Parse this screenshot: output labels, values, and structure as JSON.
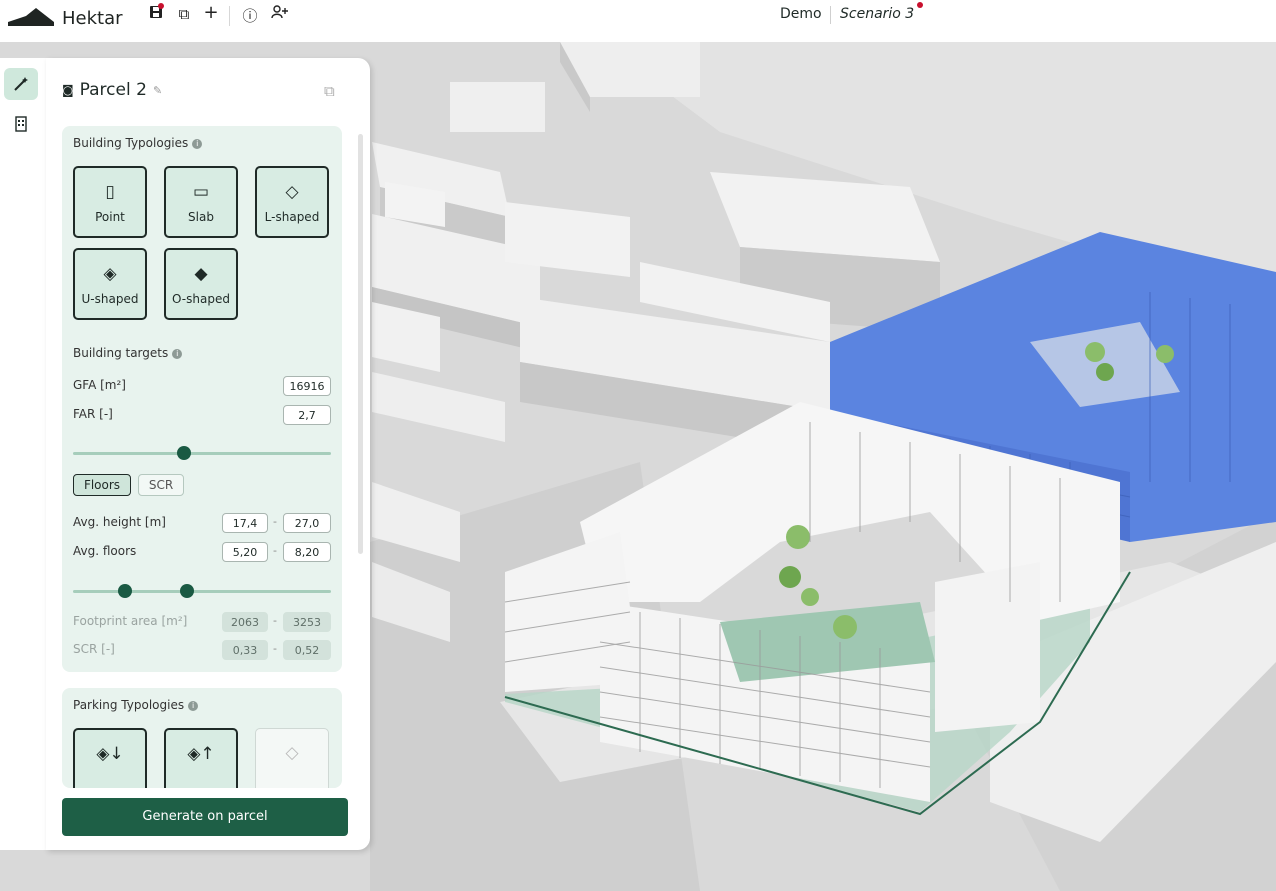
{
  "app": {
    "brand": "Hektar",
    "project": "Demo",
    "scenario": "Scenario 3"
  },
  "colors": {
    "accent": "#1e5f46",
    "tile_bg": "#d8ece3",
    "card_bg": "#e8f3ee",
    "selected_blocks": "#5b84e0",
    "notification": "#c8102e"
  },
  "toolbar": {
    "icons": [
      "save-icon",
      "duplicate-icon",
      "plus-icon",
      "info-icon",
      "add-user-icon"
    ]
  },
  "panel": {
    "title": "Parcel 2",
    "building_typologies": {
      "title": "Building Typologies",
      "items": [
        {
          "label": "Point",
          "icon": "point-building-icon"
        },
        {
          "label": "Slab",
          "icon": "slab-building-icon"
        },
        {
          "label": "L-shaped",
          "icon": "l-shaped-building-icon"
        },
        {
          "label": "U-shaped",
          "icon": "u-shaped-building-icon"
        },
        {
          "label": "O-shaped",
          "icon": "o-shaped-building-icon"
        }
      ]
    },
    "building_targets": {
      "title": "Building targets",
      "gfa_label": "GFA [m²]",
      "gfa_value": "16916",
      "far_label": "FAR [-]",
      "far_value": "2,7",
      "far_slider_fraction": 0.43,
      "toggle_floors": "Floors",
      "toggle_scr": "SCR",
      "avg_height_label": "Avg. height [m]",
      "avg_height_min": "17,4",
      "avg_height_max": "27,0",
      "avg_floors_label": "Avg. floors",
      "avg_floors_min": "5,20",
      "avg_floors_max": "8,20",
      "floors_range_fraction": [
        0.2,
        0.44
      ],
      "footprint_label": "Footprint area [m²]",
      "footprint_min": "2063",
      "footprint_max": "3253",
      "scr_label": "SCR [-]",
      "scr_min": "0,33",
      "scr_max": "0,52",
      "range_sep": "-"
    },
    "parking_typologies": {
      "title": "Parking Typologies"
    },
    "generate_label": "Generate on parcel"
  }
}
